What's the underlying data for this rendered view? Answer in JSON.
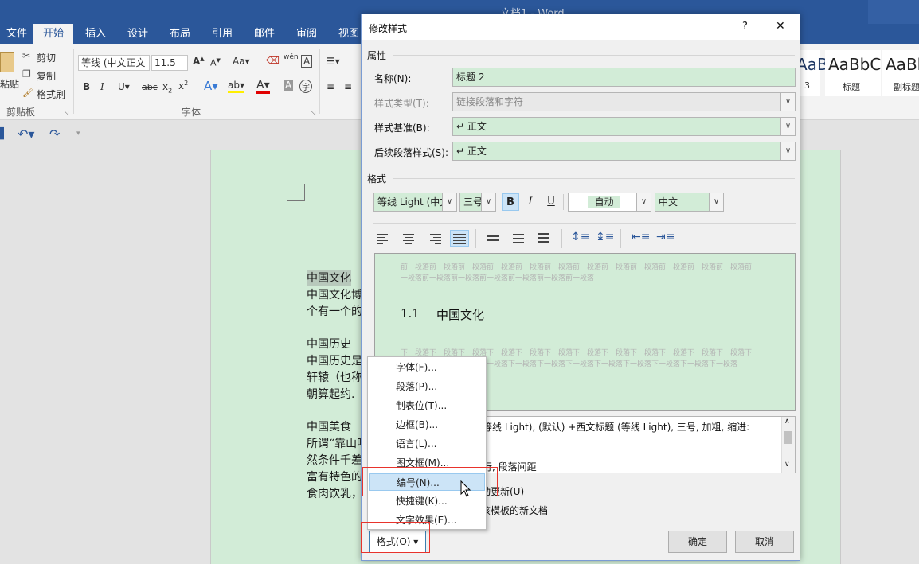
{
  "window": {
    "title": "文档1 - Word"
  },
  "ribbon": {
    "tabs": [
      "文件",
      "开始",
      "插入",
      "设计",
      "布局",
      "引用",
      "邮件",
      "审阅",
      "视图"
    ],
    "clipboard": {
      "paste": "粘贴",
      "cut": "剪切",
      "copy": "复制",
      "format_painter": "格式刷",
      "group": "剪贴板"
    },
    "font": {
      "name": "等线 (中文正文",
      "size": "11.5",
      "case": "Aa",
      "group": "字体",
      "wen": "wén"
    },
    "styles": [
      {
        "preview": "AaBbC",
        "name": "3"
      },
      {
        "preview": "AaBbC",
        "name": "标题"
      },
      {
        "preview": "AaBl",
        "name": "副标题"
      }
    ]
  },
  "document": {
    "lines": [
      "中国文化",
      "中国文化博",
      "个有一个的",
      "",
      "中国历史",
      "中国历史是",
      "轩辕（也称",
      "朝算起约.",
      "",
      "中国美食",
      "所谓“靠山吃",
      "然条件千差",
      "富有特色的",
      "食肉饮乳，"
    ]
  },
  "dialog": {
    "title": "修改样式",
    "help": "?",
    "close": "✕",
    "section_properties": "属性",
    "name_label": "名称(N):",
    "name_value": "标题 2",
    "type_label": "样式类型(T):",
    "type_value": "链接段落和字符",
    "base_label": "样式基准(B):",
    "base_value": "↵ 正文",
    "next_label": "后续段落样式(S):",
    "next_value": "↵ 正文",
    "section_format": "格式",
    "font_value": "等线 Light (中文",
    "size_value": "三号",
    "bold": "B",
    "italic": "I",
    "underline": "U",
    "color_value": "自动",
    "lang_value": "中文",
    "preview_prev": "前一段落前一段落前一段落前一段落前一段落前一段落前一段落前一段落前一段落前一段落前一段落前一段落前一段落前一段落前一段落前一段落前一段落前一段落前一段落",
    "preview_heading_num": "1.1",
    "preview_heading_text": "中国文化",
    "preview_next": "下一段落下一段落下一段落下一段落下一段落下一段落下一段落下一段落下一段落下一段落下一段落下一段落下一段落下一段落下一段落下一段落下一段落下一段落下一段落下一段落下一段落下一段落下一段落下一段落",
    "desc_line1": "等线 Light), (默认) +西文标题 (等线 Light), 三号, 加粗, 缩进:",
    "desc_line3": "行, 段落间距",
    "auto_update": "动更新(U)",
    "new_docs": "该模板的新文档",
    "format_button": "格式(O) ▾",
    "ok": "确定",
    "cancel": "取消"
  },
  "menu": {
    "items": [
      "字体(F)...",
      "段落(P)...",
      "制表位(T)...",
      "边框(B)...",
      "语言(L)...",
      "图文框(M)...",
      "编号(N)...",
      "快捷键(K)...",
      "文字效果(E)..."
    ],
    "highlighted": 6
  }
}
